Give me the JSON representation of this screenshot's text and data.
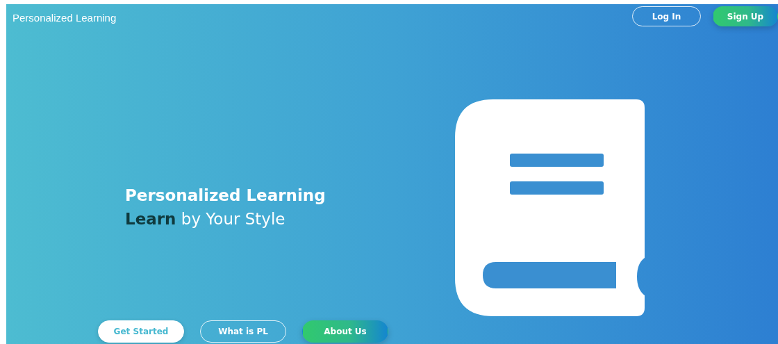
{
  "nav": {
    "brand": "Personalized Learning",
    "buttons": [
      {
        "label": "Log In",
        "kind": "outline"
      },
      {
        "label": "Sign Up",
        "kind": "gradient"
      }
    ]
  },
  "hero": {
    "title": "Personalized Learning",
    "subtitle": "**Learn** by Your Style",
    "actions": [
      {
        "label": "Get Started",
        "kind": "solid"
      },
      {
        "label": "What is PL",
        "kind": "outline"
      },
      {
        "label": "About Us",
        "kind": "gradient"
      }
    ]
  }
}
